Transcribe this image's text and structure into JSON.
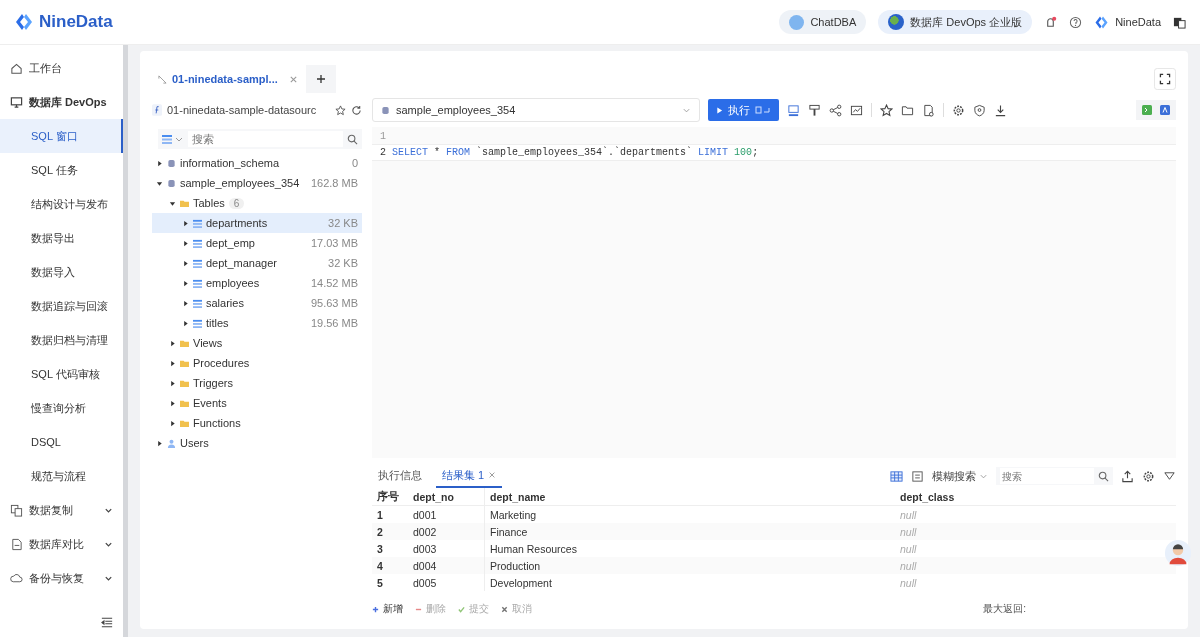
{
  "header": {
    "brand": "NineData",
    "chatdba": "ChatDBA",
    "edition": "数据库 DevOps 企业版",
    "account": "NineData",
    "notification_dot": true
  },
  "sidebar": {
    "items": [
      {
        "label": "工作台",
        "kind": "top",
        "selected": false
      },
      {
        "label": "数据库 DevOps",
        "kind": "group",
        "expanded": true,
        "selected": false,
        "children": [
          {
            "label": "SQL 窗口",
            "selected": true
          },
          {
            "label": "SQL 任务",
            "selected": false
          },
          {
            "label": "结构设计与发布",
            "selected": false
          },
          {
            "label": "数据导出",
            "selected": false
          },
          {
            "label": "数据导入",
            "selected": false
          },
          {
            "label": "数据追踪与回滚",
            "selected": false
          },
          {
            "label": "数据归档与清理",
            "selected": false
          },
          {
            "label": "SQL 代码审核",
            "selected": false
          },
          {
            "label": "慢查询分析",
            "selected": false
          },
          {
            "label": "DSQL",
            "selected": false
          },
          {
            "label": "规范与流程",
            "selected": false
          }
        ]
      },
      {
        "label": "数据复制",
        "kind": "group",
        "expanded": false,
        "selected": false
      },
      {
        "label": "数据库对比",
        "kind": "group",
        "expanded": false,
        "selected": false
      },
      {
        "label": "备份与恢复",
        "kind": "group",
        "expanded": false,
        "selected": false
      }
    ]
  },
  "tabs": [
    {
      "label": "01-ninedata-sampl...",
      "selected": true
    }
  ],
  "datasource": "01-ninedata-sample-datasourc",
  "tree_search": {
    "placeholder": "搜索"
  },
  "tree": [
    {
      "label": "information_schema",
      "kind": "database",
      "size": "0",
      "expanded": false,
      "selected": false
    },
    {
      "label": "sample_employees_354",
      "kind": "database",
      "size": "162.8 MB",
      "expanded": true,
      "selected": false,
      "children": [
        {
          "label": "Tables",
          "kind": "folder",
          "badge": "6",
          "expanded": true,
          "selected": false,
          "children": [
            {
              "label": "departments",
              "kind": "table",
              "size": "32 KB",
              "expanded": false,
              "selected": true
            },
            {
              "label": "dept_emp",
              "kind": "table",
              "size": "17.03 MB",
              "expanded": false,
              "selected": false
            },
            {
              "label": "dept_manager",
              "kind": "table",
              "size": "32 KB",
              "expanded": false,
              "selected": false
            },
            {
              "label": "employees",
              "kind": "table",
              "size": "14.52 MB",
              "expanded": false,
              "selected": false
            },
            {
              "label": "salaries",
              "kind": "table",
              "size": "95.63 MB",
              "expanded": false,
              "selected": false
            },
            {
              "label": "titles",
              "kind": "table",
              "size": "19.56 MB",
              "expanded": false,
              "selected": false
            }
          ]
        },
        {
          "label": "Views",
          "kind": "folder",
          "expanded": false,
          "selected": false
        },
        {
          "label": "Procedures",
          "kind": "folder",
          "expanded": false,
          "selected": false
        },
        {
          "label": "Triggers",
          "kind": "folder",
          "expanded": false,
          "selected": false
        },
        {
          "label": "Events",
          "kind": "folder",
          "expanded": false,
          "selected": false
        },
        {
          "label": "Functions",
          "kind": "folder",
          "expanded": false,
          "selected": false
        }
      ]
    },
    {
      "label": "Users",
      "kind": "users",
      "expanded": false,
      "selected": false
    }
  ],
  "editor": {
    "database": "sample_employees_354",
    "run_button": "执行",
    "lines": [
      {
        "number": "1"
      },
      {
        "number": "2",
        "tokens": [
          {
            "text": "SELECT",
            "kind": "keyword"
          },
          {
            "text": " * ",
            "kind": "plain"
          },
          {
            "text": "FROM",
            "kind": "keyword"
          },
          {
            "text": " `sample_employees_354`.`departments` ",
            "kind": "plain"
          },
          {
            "text": "LIMIT",
            "kind": "keyword"
          },
          {
            "text": " 100",
            "kind": "number"
          },
          {
            "text": ";",
            "kind": "plain"
          }
        ]
      }
    ]
  },
  "results": {
    "tabs": [
      {
        "label": "执行信息",
        "selected": false,
        "closable": false
      },
      {
        "label": "结果集 1",
        "selected": true,
        "closable": true
      }
    ],
    "search_mode": "模糊搜索",
    "search": {
      "placeholder": "搜索"
    },
    "columns": [
      "序号",
      "dept_no",
      "dept_name",
      "dept_class"
    ],
    "rows": [
      [
        "1",
        "d001",
        "Marketing",
        "null"
      ],
      [
        "2",
        "d002",
        "Finance",
        "null"
      ],
      [
        "3",
        "d003",
        "Human Resources",
        "null"
      ],
      [
        "4",
        "d004",
        "Production",
        "null"
      ],
      [
        "5",
        "d005",
        "Development",
        "null"
      ]
    ],
    "actions": [
      {
        "label": "新增",
        "disabled": false
      },
      {
        "label": "删除",
        "disabled": true
      },
      {
        "label": "提交",
        "disabled": true
      },
      {
        "label": "取消",
        "disabled": true
      }
    ],
    "max_return": "最大返回:"
  }
}
